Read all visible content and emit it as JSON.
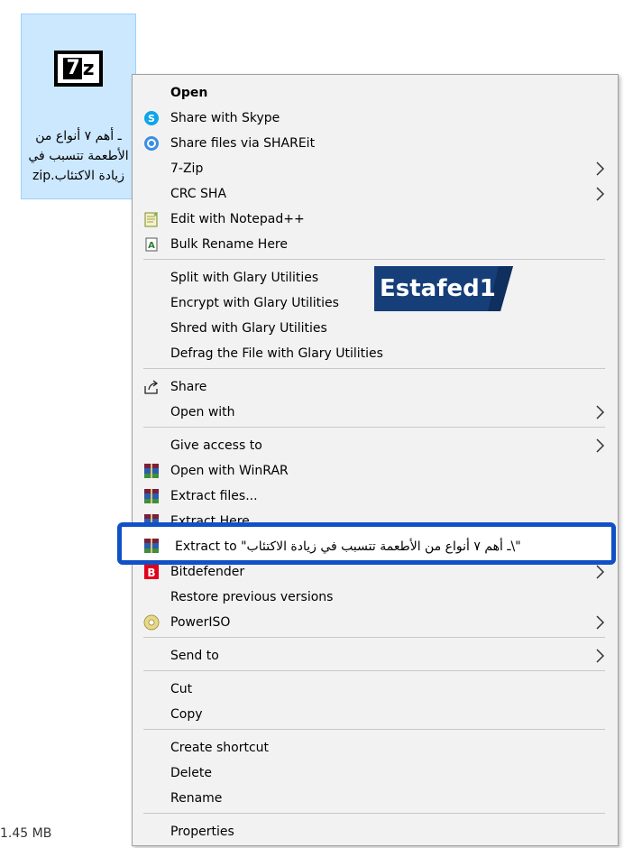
{
  "file": {
    "name": "ـ أهم ٧ أنواع من الأطعمة تتسبب في زيادة الاكتئاب.zip",
    "size_text": "1.45 MB"
  },
  "menu": {
    "items": [
      {
        "label": "Open",
        "bold": true
      },
      {
        "label": "Share with Skype",
        "icon": "skype-icon"
      },
      {
        "label": "Share files via SHAREit",
        "icon": "shareit-icon"
      },
      {
        "label": "7-Zip",
        "submenu": true
      },
      {
        "label": "CRC SHA",
        "submenu": true
      },
      {
        "label": "Edit with Notepad++",
        "icon": "notepadpp-icon"
      },
      {
        "label": "Bulk Rename Here",
        "icon": "bulk-rename-icon"
      },
      {
        "label": "Split with Glary Utilities"
      },
      {
        "label": "Encrypt with Glary Utilities"
      },
      {
        "label": "Shred with Glary Utilities"
      },
      {
        "label": "Defrag the File with Glary Utilities"
      },
      {
        "label": "Share",
        "icon": "share-icon"
      },
      {
        "label": "Open with",
        "submenu": true
      },
      {
        "label": "Give access to",
        "submenu": true
      },
      {
        "label": "Open with WinRAR",
        "icon": "winrar-icon"
      },
      {
        "label": "Extract files...",
        "icon": "winrar-icon"
      },
      {
        "label": "Extract Here",
        "icon": "winrar-icon"
      },
      {
        "label": "Extract to \"ـ أهم ٧ أنواع من الأطعمة تتسبب في زيادة الاكتئاب\\\"",
        "icon": "winrar-icon"
      },
      {
        "label": "Bitdefender",
        "icon": "bitdefender-icon",
        "submenu": true
      },
      {
        "label": "Restore previous versions"
      },
      {
        "label": "PowerISO",
        "icon": "poweriso-icon",
        "submenu": true
      },
      {
        "label": "Send to",
        "submenu": true
      },
      {
        "label": "Cut"
      },
      {
        "label": "Copy"
      },
      {
        "label": "Create shortcut"
      },
      {
        "label": "Delete"
      },
      {
        "label": "Rename"
      },
      {
        "label": "Properties"
      }
    ]
  },
  "watermark": {
    "text": "Estafed1"
  },
  "colors": {
    "menu_bg": "#f2f2f2",
    "selection_tile": "#cce8ff",
    "highlight_border": "#1150c7",
    "watermark_bg": "#163f7a"
  }
}
